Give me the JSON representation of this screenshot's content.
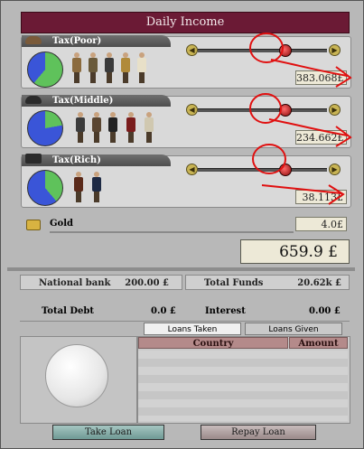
{
  "header": {
    "title": "Daily Income"
  },
  "taxes": [
    {
      "label": "Tax(Poor)",
      "value": "383.068",
      "currency": "£",
      "slider_level": 0.68,
      "hat_icon": "cap-icon",
      "pie": {
        "green_deg": 220,
        "blue_deg": 140
      }
    },
    {
      "label": "Tax(Middle)",
      "value": "234.662",
      "currency": "£",
      "slider_level": 0.68,
      "hat_icon": "bowler-hat-icon",
      "pie": {
        "green_deg": 80,
        "blue_deg": 280
      }
    },
    {
      "label": "Tax(Rich)",
      "value": "38.113",
      "currency": "£",
      "slider_level": 0.68,
      "hat_icon": "top-hat-icon",
      "pie": {
        "green_deg": 140,
        "blue_deg": 220
      }
    }
  ],
  "gold": {
    "label": "Gold",
    "value": "4.0",
    "currency": "£"
  },
  "total_income": {
    "value": "659.9",
    "currency": "£"
  },
  "finances": {
    "national_bank_label": "National bank",
    "national_bank_value": "200.00",
    "total_funds_label": "Total Funds",
    "total_funds_value": "20.62k",
    "total_debt_label": "Total Debt",
    "total_debt_value": "0.0",
    "interest_label": "Interest",
    "interest_value": "0.00",
    "currency": "£"
  },
  "loans": {
    "tabs": [
      "Loans Taken",
      "Loans Given"
    ],
    "columns": [
      "Country",
      "Amount"
    ],
    "take_loan_label": "Take Loan",
    "repay_loan_label": "Repay Loan"
  },
  "colors": {
    "header": "#6b1a35",
    "pie_green": "#5fc25b",
    "pie_blue": "#3a55d8",
    "annotation_red": "#e01010"
  }
}
